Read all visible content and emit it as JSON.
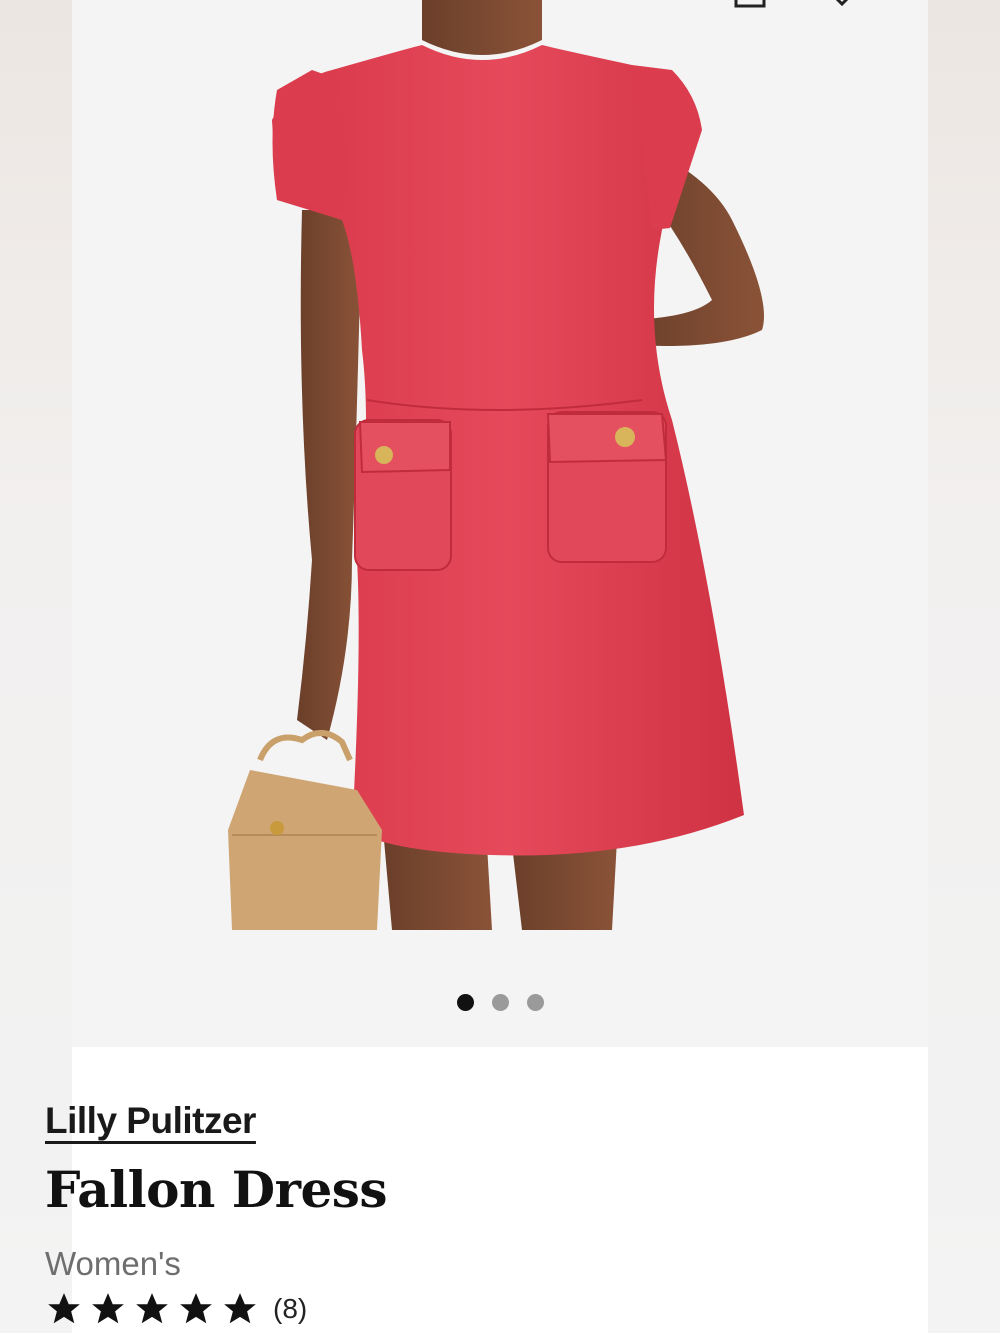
{
  "product": {
    "brand": "Lilly Pulitzer",
    "name": "Fallon Dress",
    "category": "Women's",
    "rating_value": 5,
    "review_count": "(8)"
  },
  "gallery": {
    "total_images": 3,
    "active_index": 0
  },
  "header_icons": [
    "bag-icon",
    "heart-icon"
  ],
  "colors": {
    "dress": "#e0404f",
    "accent_active_dot": "#111111",
    "inactive_dot": "#9a9a9a"
  }
}
